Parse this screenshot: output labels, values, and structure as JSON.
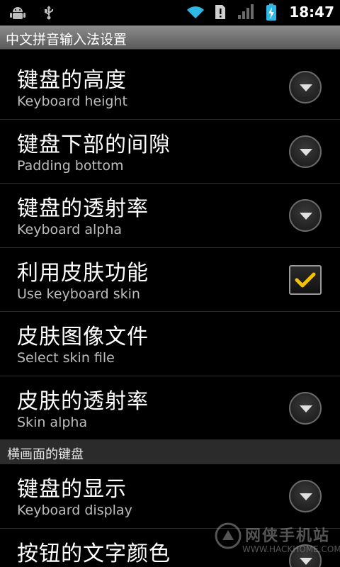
{
  "status_bar": {
    "icons_left": [
      "android-debug-icon",
      "usb-icon"
    ],
    "icons_right": [
      "wifi-icon",
      "alert-icon",
      "signal-icon",
      "battery-charging-icon"
    ],
    "time": "18:47"
  },
  "header": {
    "title": "中文拼音输入法设置"
  },
  "settings": [
    {
      "title": "键盘的高度",
      "subtitle": "Keyboard height",
      "control": "dropdown"
    },
    {
      "title": "键盘下部的间隙",
      "subtitle": "Padding bottom",
      "control": "dropdown"
    },
    {
      "title": "键盘的透射率",
      "subtitle": "Keyboard alpha",
      "control": "dropdown"
    },
    {
      "title": "利用皮肤功能",
      "subtitle": "Use keyboard skin",
      "control": "checkbox",
      "checked": true
    },
    {
      "title": "皮肤图像文件",
      "subtitle": "Select skin file",
      "control": "none"
    },
    {
      "title": "皮肤的透射率",
      "subtitle": "Skin alpha",
      "control": "dropdown"
    }
  ],
  "section": {
    "title": "横画面的键盘"
  },
  "settings2": [
    {
      "title": "键盘的显示",
      "subtitle": "Keyboard display",
      "control": "dropdown"
    },
    {
      "title": "按钮的文字颜色",
      "subtitle": "",
      "control": "dropdown"
    }
  ],
  "watermark": {
    "name": "网侠手机站",
    "url": "WWW.HACKHOME.COM"
  },
  "colors": {
    "accent_check": "#f2c200",
    "background": "#000000",
    "title_bar": "#7a7a7a"
  }
}
